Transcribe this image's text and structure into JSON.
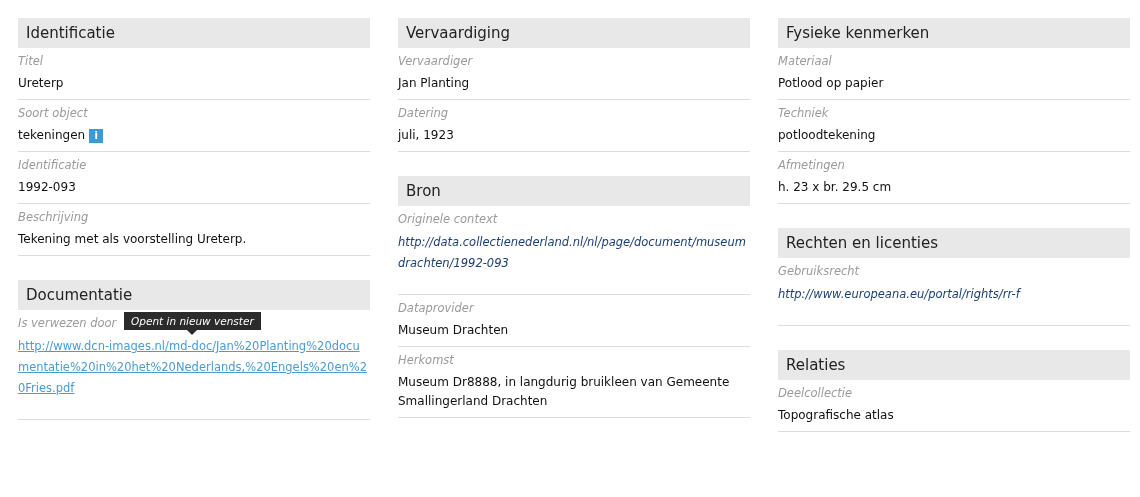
{
  "columns": [
    {
      "sections": [
        {
          "title": "Identificatie",
          "fields": [
            {
              "label": "Titel",
              "kind": "text",
              "value": "Ureterp"
            },
            {
              "label": "Soort object",
              "kind": "info",
              "value": "tekeningen",
              "icon_text": "i"
            },
            {
              "label": "Identificatie",
              "kind": "text",
              "value": "1992-093"
            },
            {
              "label": "Beschrijving",
              "kind": "text",
              "value": "Tekening met als voorstelling Ureterp."
            }
          ]
        },
        {
          "title": "Documentatie",
          "fields": [
            {
              "label": "Is verwezen door",
              "kind": "link",
              "value": "http://www.dcn-images.nl/md-doc/Jan%20Planting%20documentatie%20in%20het%20Nederlands,%20Engels%20en%20Fries.pdf",
              "tooltip": "Opent in nieuw venster"
            }
          ]
        }
      ]
    },
    {
      "sections": [
        {
          "title": "Vervaardiging",
          "fields": [
            {
              "label": "Vervaardiger",
              "kind": "text",
              "value": "Jan Planting"
            },
            {
              "label": "Datering",
              "kind": "text",
              "value": "juli, 1923"
            }
          ]
        },
        {
          "title": "Bron",
          "fields": [
            {
              "label": "Originele context",
              "kind": "url",
              "value": "http://data.collectienederland.nl/nl/page/document/museumdrachten/1992-093"
            },
            {
              "label": "Dataprovider",
              "kind": "text",
              "value": "Museum Drachten"
            },
            {
              "label": "Herkomst",
              "kind": "text",
              "value": "Museum Dr8888, in langdurig bruikleen van Gemeente Smallingerland Drachten"
            }
          ]
        }
      ]
    },
    {
      "sections": [
        {
          "title": "Fysieke kenmerken",
          "fields": [
            {
              "label": "Materiaal",
              "kind": "text",
              "value": "Potlood op papier"
            },
            {
              "label": "Techniek",
              "kind": "text",
              "value": "potloodtekening"
            },
            {
              "label": "Afmetingen",
              "kind": "text",
              "value": "h. 23 x br. 29.5 cm"
            }
          ]
        },
        {
          "title": "Rechten en licenties",
          "fields": [
            {
              "label": "Gebruiksrecht",
              "kind": "url",
              "value": "http://www.europeana.eu/portal/rights/rr-f"
            }
          ]
        },
        {
          "title": "Relaties",
          "fields": [
            {
              "label": "Deelcollectie",
              "kind": "text",
              "value": "Topografische atlas"
            }
          ]
        }
      ]
    }
  ]
}
